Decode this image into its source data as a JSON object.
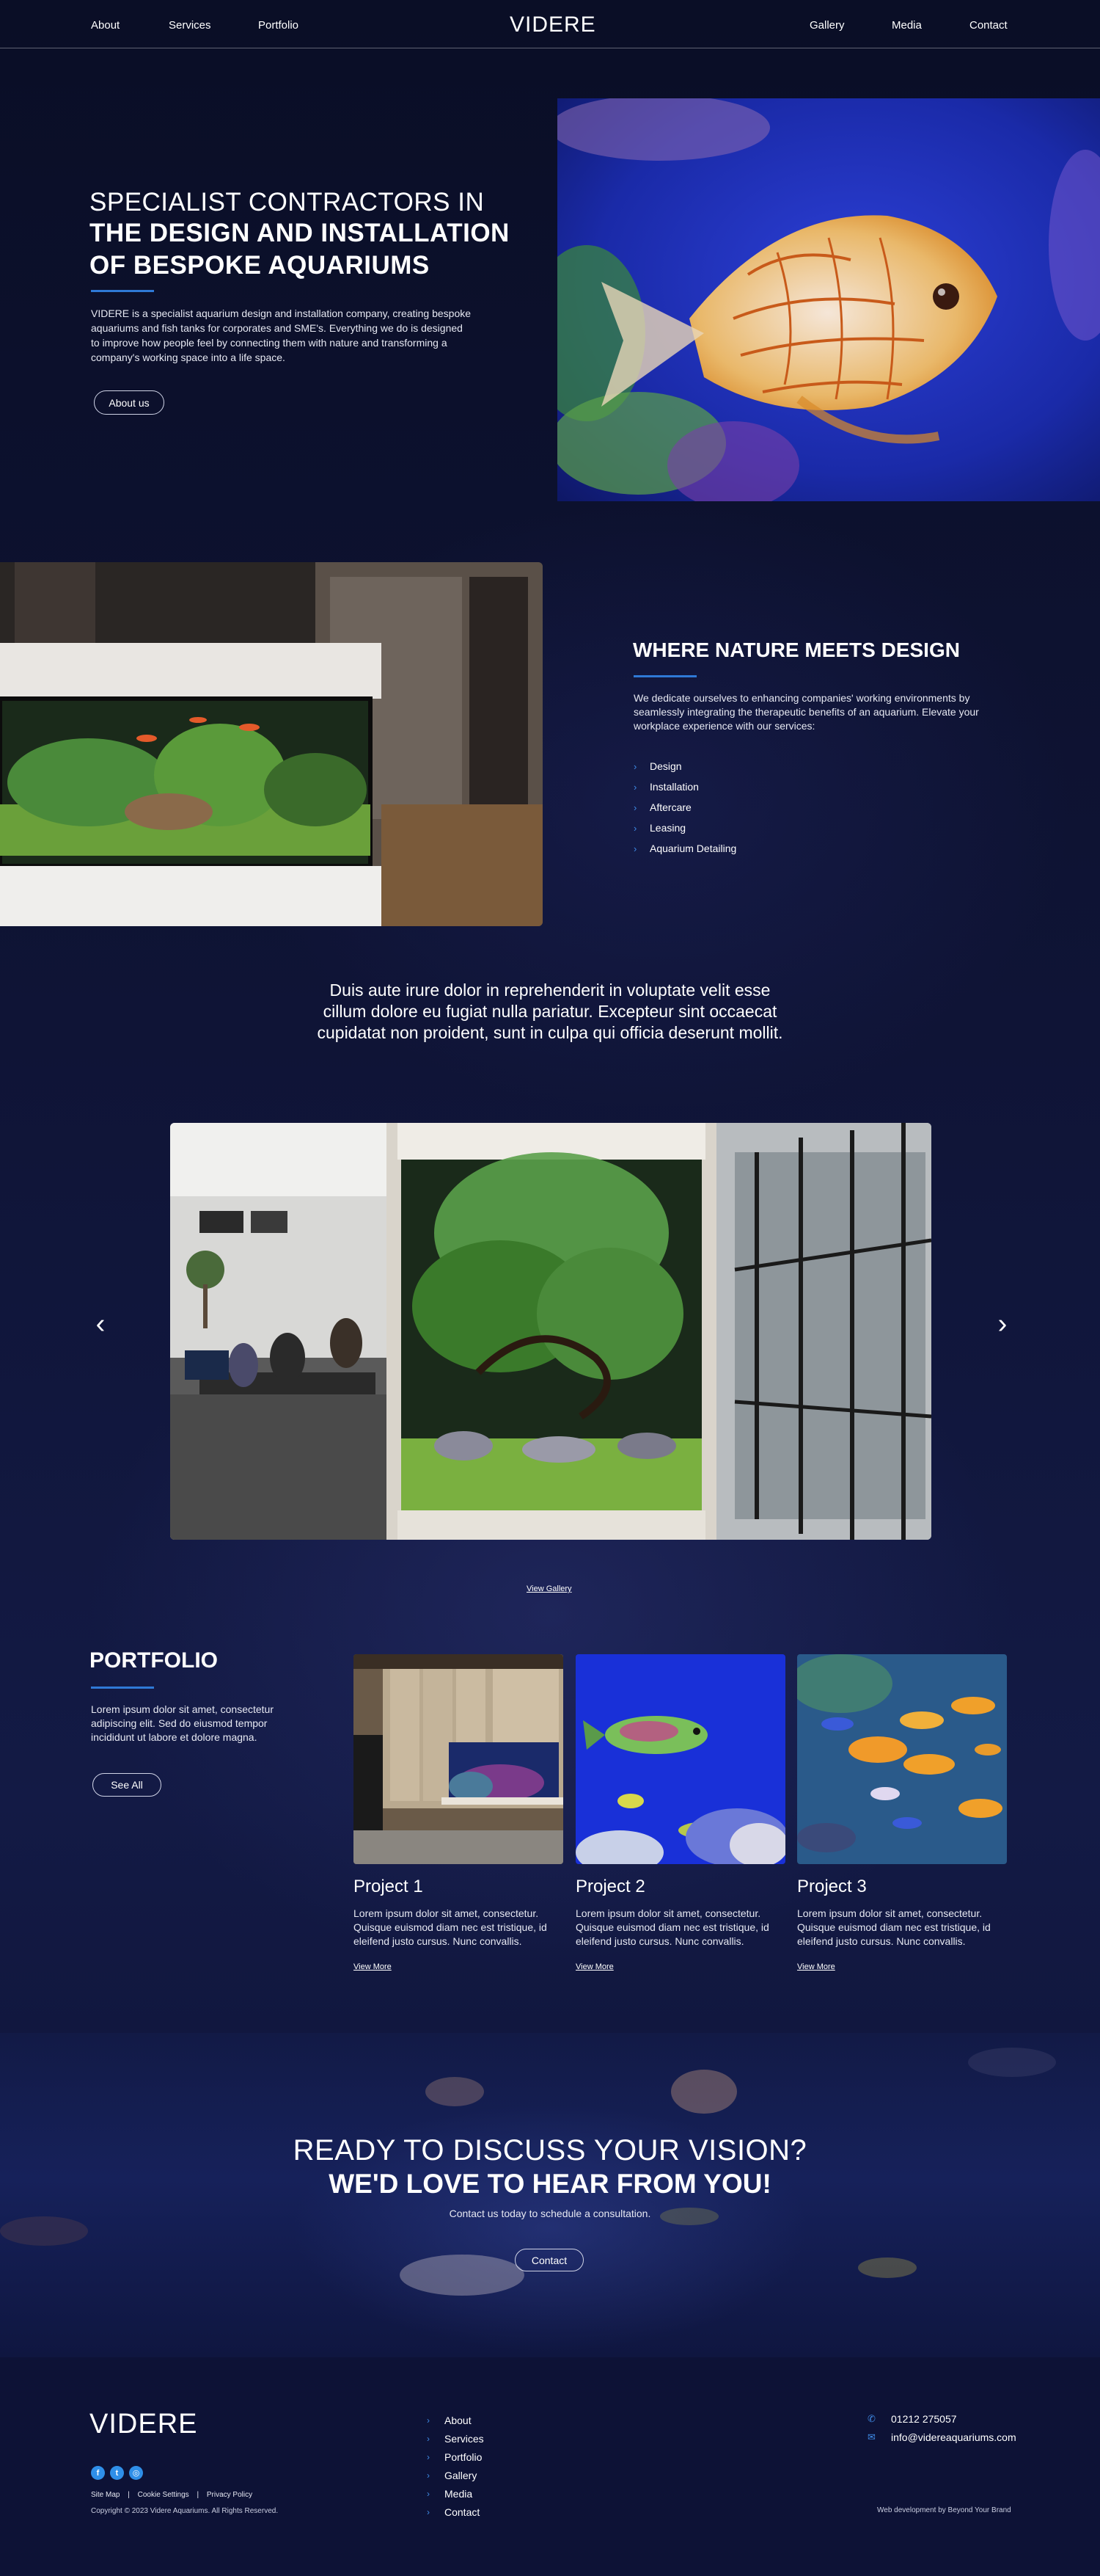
{
  "brand": {
    "logo_text": "VIDERE"
  },
  "nav": {
    "left": [
      "About",
      "Services",
      "Portfolio"
    ],
    "right": [
      "Gallery",
      "Media",
      "Contact"
    ]
  },
  "hero": {
    "title_light": "SPECIALIST CONTRACTORS IN",
    "title_bold": "THE DESIGN AND INSTALLATION OF BESPOKE AQUARIUMS",
    "body": "VIDERE is a specialist aquarium design and installation company, creating bespoke aquariums and fish tanks for corporates and SME's. Everything we do is designed to improve how people feel by connecting them with nature and transforming a company's working space into a life space.",
    "button": "About us"
  },
  "nature": {
    "title": "WHERE NATURE MEETS DESIGN",
    "body": "We dedicate ourselves to enhancing companies' working environments by seamlessly integrating the therapeutic benefits of an aquarium. Elevate your workplace experience with our services:",
    "services": [
      "Design",
      "Installation",
      "Aftercare",
      "Leasing",
      "Aquarium Detailing"
    ]
  },
  "quote": {
    "text": "Duis aute irure dolor in reprehenderit in voluptate velit esse cillum dolore eu fugiat nulla pariatur. Excepteur sint occaecat cupidatat non proident, sunt in culpa qui officia deserunt mollit."
  },
  "gallery": {
    "prev": "‹",
    "next": "›",
    "view_link": "View Gallery"
  },
  "portfolio": {
    "title": "PORTFOLIO",
    "body": "Lorem ipsum dolor sit amet, consectetur adipiscing elit. Sed do eiusmod tempor incididunt ut labore et dolore magna.",
    "button": "See All",
    "projects": [
      {
        "title": "Project 1",
        "text": "Lorem ipsum dolor sit amet, consectetur. Quisque euismod diam nec est tristique, id eleifend justo cursus. Nunc convallis.",
        "link": "View More"
      },
      {
        "title": "Project 2",
        "text": "Lorem ipsum dolor sit amet, consectetur. Quisque euismod diam nec est tristique, id eleifend justo cursus. Nunc convallis.",
        "link": "View More"
      },
      {
        "title": "Project 3",
        "text": "Lorem ipsum dolor sit amet, consectetur. Quisque euismod diam nec est tristique, id eleifend justo cursus. Nunc convallis.",
        "link": "View More"
      }
    ]
  },
  "cta": {
    "line1": "READY TO DISCUSS YOUR VISION?",
    "line2": "WE'D LOVE TO HEAR FROM YOU!",
    "sub": "Contact us today to schedule a consultation.",
    "button": "Contact"
  },
  "footer": {
    "logo_text": "VIDERE",
    "social": [
      "facebook-icon",
      "twitter-icon",
      "instagram-icon"
    ],
    "legal": [
      "Site Map",
      "|",
      "Cookie Settings",
      "|",
      "Privacy Policy"
    ],
    "copyright": "Copyright © 2023 Videre Aquariums. All Rights Reserved.",
    "links": [
      "About",
      "Services",
      "Portfolio",
      "Gallery",
      "Media",
      "Contact"
    ],
    "phone": "01212 275057",
    "email": "info@videreaquariums.com",
    "credit": "Web development by Beyond Your Brand"
  },
  "colors": {
    "background": "#0b0f2a",
    "accent": "#2f79d6",
    "text": "#ffffff"
  }
}
